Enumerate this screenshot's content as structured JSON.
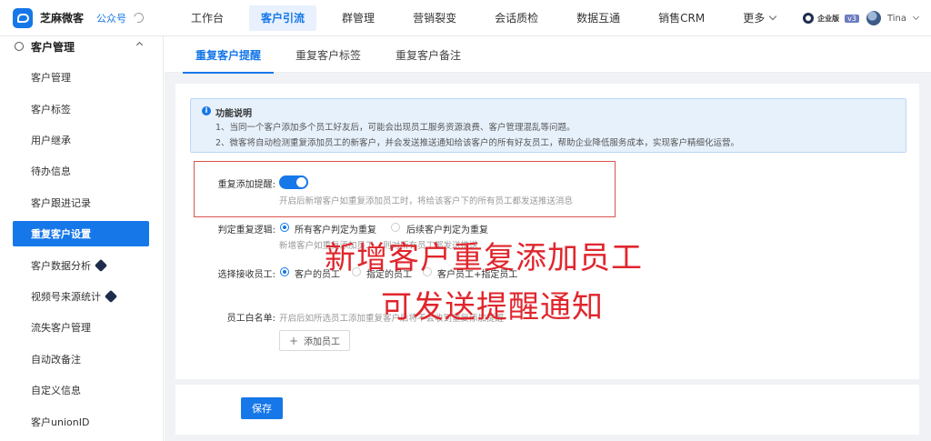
{
  "header": {
    "brand": "芝麻微客",
    "sub": "公众号",
    "nav": [
      "工作台",
      "客户引流",
      "群管理",
      "营销裂变",
      "会话质检",
      "数据互通",
      "销售CRM",
      "更多"
    ],
    "active_nav": "客户引流",
    "edition": "企业版",
    "version": "v3",
    "user": "Tina"
  },
  "sidebar": {
    "group": "客户管理",
    "items": [
      "客户管理",
      "客户标签",
      "用户继承",
      "待办信息",
      "客户跟进记录",
      "重复客户设置",
      "客户数据分析",
      "视频号来源统计",
      "流失客户管理",
      "自动改备注",
      "自定义信息",
      "客户unionID"
    ],
    "active": "重复客户设置"
  },
  "tabs": [
    "重复客户提醒",
    "重复客户标签",
    "重复客户备注"
  ],
  "info": {
    "title": "功能说明",
    "line1": "1、当同一个客户添加多个员工好友后，可能会出现员工服务资源浪费、客户管理混乱等问题。",
    "line2": "2、微客将自动检测重复添加员工的新客户，并会发送推送通知给该客户的所有好友员工，帮助企业降低服务成本，实现客户精细化运营。"
  },
  "form": {
    "reminder_label": "重复添加提醒:",
    "reminder_on": true,
    "reminder_hint": "开启后新增客户如重复添加员工时，将给该客户下的所有员工都发送推送消息",
    "logic_label": "判定重复逻辑:",
    "logic_opt1": "所有客户判定为重复",
    "logic_opt2": "后续客户判定为重复",
    "logic_hint": "新增客户如重复添加员工，则对所有员工都发送推送",
    "receiver_label": "选择接收员工:",
    "receiver_opt1": "客户的员工",
    "receiver_opt2": "指定的员工",
    "receiver_opt3": "客户员工+指定员工",
    "whitelist_label": "员工白名单:",
    "whitelist_hint": "开启后如所选员工添加重复客户后将不会收到重复添加提醒",
    "add_staff": "添加员工",
    "save": "保存"
  },
  "overlay": {
    "line1": "新增客户重复添加员工",
    "line2": "可发送提醒通知"
  },
  "colors": {
    "primary": "#1677e8",
    "annotation": "#e0262d"
  }
}
